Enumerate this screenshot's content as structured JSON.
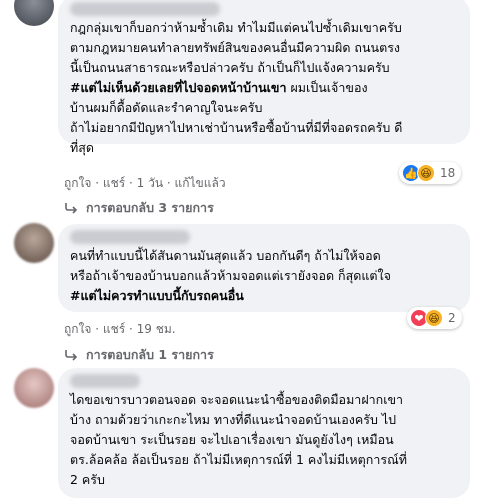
{
  "comments": [
    {
      "lines": [
        "กฎกลุ่มเขาก็บอกว่าห้ามซ้ำเดิม ทำไมมีแต่คนไปซ้ำเดิมเขาครับ",
        "ตามกฎหมายคนทำลายทรัพย์สินของคนอื่นมีความผิด ถนนตรง",
        "นี้เป็นถนนสาธารณะหรือปล่าวครับ ถ้าเป็นก็ไปแจ้งความครับ",
        "#แต่ไม่เห็นด้วยเลยที่ไปจอดหน้าบ้านเขา",
        "บ้านผมก็ดื้อดัดและรำคาญใจนะครับ",
        "ถ้าไม่อยากมีปัญหาไปหาเช่าบ้านหรือซื้อบ้านที่มีที่จอดรถครับ ดี",
        "ที่สุด"
      ],
      "line4_tail": " ผมเป็นเจ้าของ",
      "actions": {
        "like": "ถูกใจ",
        "reply": "แชร์",
        "time": "1 วัน",
        "edited": "แก้ไขแล้ว"
      },
      "reaction_count": "18",
      "replies": "การตอบกลับ 3 รายการ"
    },
    {
      "lines": [
        "คนที่ทำแบบนี้ได้สันดานมันสุดแล้ว บอกกันดีๆ ถ้าไม่ให้จอด",
        "หรือถ้าเจ้าของบ้านบอกแล้วห้ามจอดแต่เรายังจอด ก็สุดแต่ใจ",
        "#แต่ไม่ควรทำแบบนี้กับรถคนอื่น"
      ],
      "actions": {
        "like": "ถูกใจ",
        "reply": "แชร์",
        "time": "19 ชม."
      },
      "reaction_count": "2",
      "replies": "การตอบกลับ 1 รายการ"
    },
    {
      "lines": [
        "ไดขอเขารบาวตอนจอด จะจอดแนะนำซื้อของติดมือมาฝากเขา",
        "บ้าง ถามด้วยว่าเกะกะไหม ทางที่ดีแนะนำจอดบ้านเองครับ ไป",
        "จอดบ้านเขา ระเป็นรอย จะไปเอาเรื่องเขา มันดูยังไงๆ เหมือน",
        "ตร.ล้อคล้อ ล้อเป็นรอย ถ้าไม่มีเหตุการณ์ที่ 1 คงไม่มีเหตุการณ์ที่",
        "2 ครับ"
      ]
    }
  ],
  "separator": " · "
}
